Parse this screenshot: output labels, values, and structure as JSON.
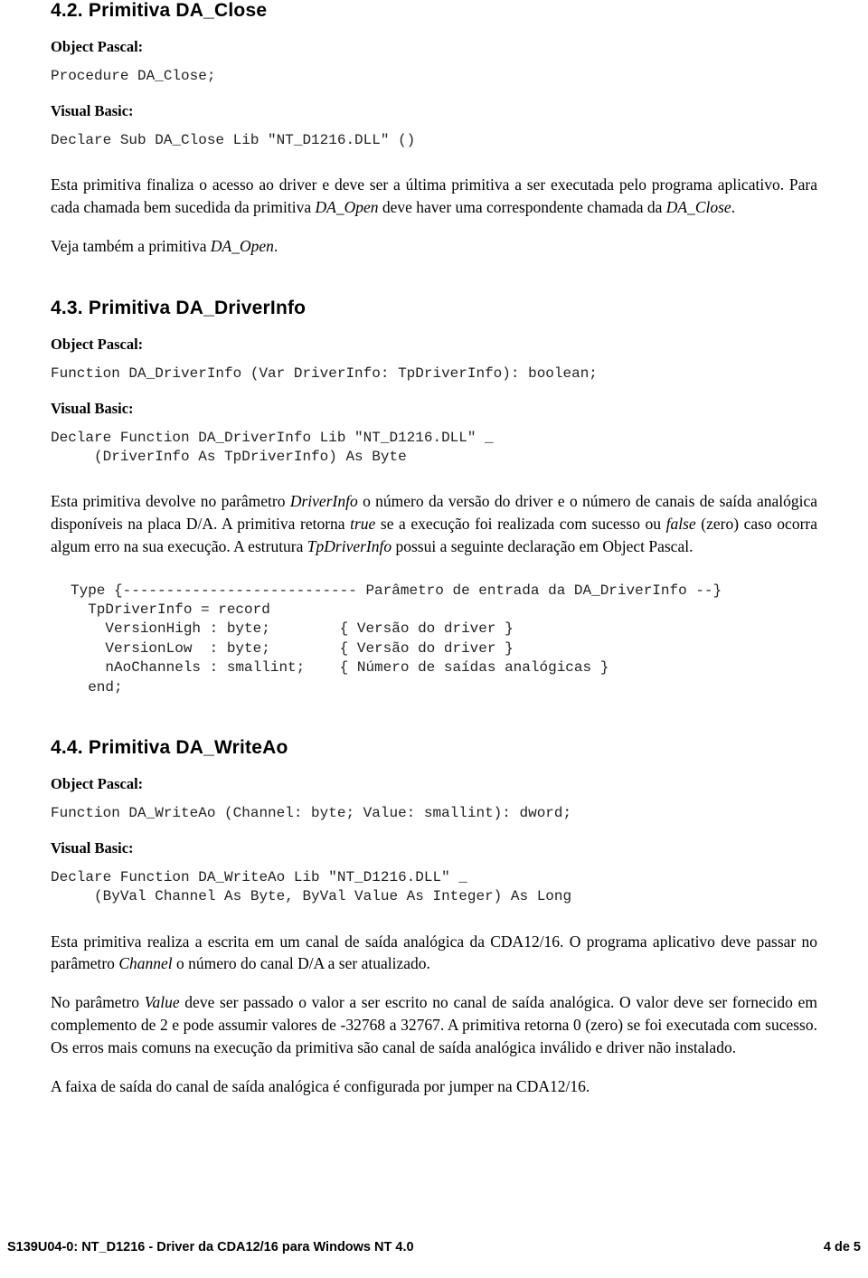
{
  "document": {
    "sections": [
      {
        "heading": "4.2. Primitiva DA_Close",
        "object_pascal_label": "Object Pascal:",
        "object_pascal_code": "Procedure DA_Close;",
        "visual_basic_label": "Visual Basic:",
        "visual_basic_code": "Declare Sub DA_Close Lib \"NT_D1216.DLL\" ()",
        "paragraphs": [
          "Esta primitiva finaliza o acesso ao driver e deve ser a última primitiva a ser executada pelo programa aplicativo. Para cada chamada bem sucedida da primitiva DA_Open deve haver uma correspondente chamada da DA_Close.",
          "Veja também a primitiva DA_Open."
        ]
      },
      {
        "heading": "4.3. Primitiva DA_DriverInfo",
        "object_pascal_label": "Object Pascal:",
        "object_pascal_code": "Function DA_DriverInfo (Var DriverInfo: TpDriverInfo): boolean;",
        "visual_basic_label": "Visual Basic:",
        "visual_basic_code": "Declare Function DA_DriverInfo Lib \"NT_D1216.DLL\" _\n     (DriverInfo As TpDriverInfo) As Byte",
        "paragraph": "Esta primitiva devolve no parâmetro DriverInfo o número da versão do driver e o número de canais de saída analógica disponíveis na placa D/A. A primitiva retorna true se a execução foi realizada com sucesso ou false (zero) caso ocorra algum erro na sua execução. A estrutura TpDriverInfo possui a seguinte declaração em Object Pascal.",
        "record_code": "Type {--------------------------- Parâmetro de entrada da DA_DriverInfo --}\n  TpDriverInfo = record\n    VersionHigh : byte;        { Versão do driver }\n    VersionLow  : byte;        { Versão do driver }\n    nAoChannels : smallint;    { Número de saídas analógicas }\n  end;"
      },
      {
        "heading": "4.4.  Primitiva DA_WriteAo",
        "object_pascal_label": "Object Pascal:",
        "object_pascal_code": "Function DA_WriteAo (Channel: byte; Value: smallint): dword;",
        "visual_basic_label": "Visual Basic:",
        "visual_basic_code": "Declare Function DA_WriteAo Lib \"NT_D1216.DLL\" _\n     (ByVal Channel As Byte, ByVal Value As Integer) As Long",
        "paragraphs": [
          "Esta primitiva realiza a escrita em um canal de saída analógica da CDA12/16. O programa aplicativo deve passar no parâmetro Channel o número do canal D/A a ser atualizado.",
          "No parâmetro Value deve ser passado o valor a ser escrito no canal de saída analógica. O valor deve ser fornecido em complemento de 2 e pode assumir valores de -32768 a 32767. A primitiva retorna 0 (zero) se foi executada com sucesso. Os erros mais comuns na execução da primitiva são canal de saída analógica inválido e driver não instalado.",
          "A faixa de saída do canal de saída analógica é configurada por jumper na CDA12/16."
        ]
      }
    ]
  },
  "footer": {
    "left": "S139U04-0: NT_D1216 - Driver da CDA12/16 para Windows  NT 4.0",
    "right": "4 de 5"
  }
}
